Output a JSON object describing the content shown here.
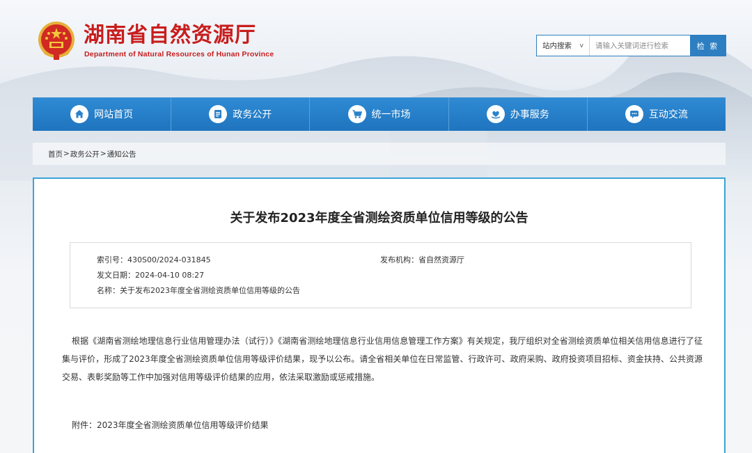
{
  "header": {
    "title": "湖南省自然资源厅",
    "subtitle": "Department of Natural Resources of Hunan Province"
  },
  "search": {
    "scope_label": "站内搜索",
    "scope_chevron": "v",
    "placeholder": "请输入关键词进行检索",
    "button_label": "检 索"
  },
  "nav": {
    "items": [
      {
        "label": "网站首页",
        "icon": "home-icon"
      },
      {
        "label": "政务公开",
        "icon": "document-icon"
      },
      {
        "label": "统一市场",
        "icon": "cart-icon"
      },
      {
        "label": "办事服务",
        "icon": "heart-hand-icon"
      },
      {
        "label": "互动交流",
        "icon": "chat-icon"
      }
    ]
  },
  "breadcrumb": {
    "items": [
      "首页",
      "政务公开",
      "通知公告"
    ],
    "separator": ">"
  },
  "article": {
    "title": "关于发布2023年度全省测绘资质单位信用等级的公告",
    "meta": {
      "index_label": "索引号：",
      "index_value": "430S00/2024-031845",
      "publisher_label": "发布机构：",
      "publisher_value": "省自然资源厅",
      "date_label": "发文日期：",
      "date_value": "2024-04-10 08:27",
      "name_label": "名称：",
      "name_value": "关于发布2023年度全省测绘资质单位信用等级的公告"
    },
    "body": "根据《湖南省测绘地理信息行业信用管理办法（试行）》《湖南省测绘地理信息行业信用信息管理工作方案》有关规定，我厅组织对全省测绘资质单位相关信用信息进行了征集与评价，形成了2023年度全省测绘资质单位信用等级评价结果，现予以公布。请全省相关单位在日常监管、行政许可、政府采购、政府投资项目招标、资金扶持、公共资源交易、表彰奖励等工作中加强对信用等级评价结果的应用，依法采取激励或惩戒措施。",
    "attachment": "附件：2023年度全省测绘资质单位信用等级评价结果"
  },
  "colors": {
    "brand_red": "#c81d1d",
    "nav_blue": "#2a82cb",
    "panel_border": "#3aa3d6"
  }
}
